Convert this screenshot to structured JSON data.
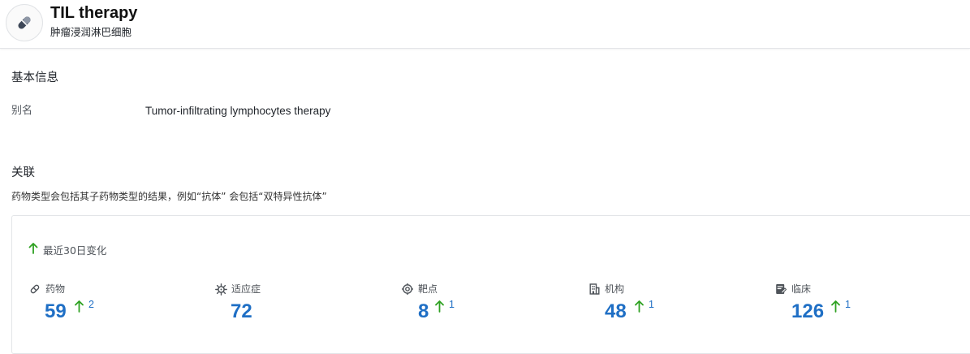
{
  "header": {
    "title": "TIL therapy",
    "subtitle": "肿瘤浸润淋巴细胞",
    "icon": "pill-icon"
  },
  "basic_info": {
    "section_title": "基本信息",
    "fields": [
      {
        "label": "别名",
        "value": "Tumor-infiltrating lymphocytes therapy"
      }
    ]
  },
  "related": {
    "section_title": "关联",
    "note": "药物类型会包括其子药物类型的结果，例如“抗体” 会包括“双特异性抗体”",
    "change_label": "最近30日变化",
    "stats": [
      {
        "label": "药物",
        "icon": "pill-icon",
        "value": "59",
        "delta": "2"
      },
      {
        "label": "适应症",
        "icon": "virus-icon",
        "value": "72",
        "delta": ""
      },
      {
        "label": "靶点",
        "icon": "target-icon",
        "value": "8",
        "delta": "1"
      },
      {
        "label": "机构",
        "icon": "building-icon",
        "value": "48",
        "delta": "1"
      },
      {
        "label": "临床",
        "icon": "clipboard-icon",
        "value": "126",
        "delta": "1"
      }
    ]
  },
  "colors": {
    "accent": "#1f6fc5",
    "up_arrow": "#2ea121",
    "icon": "#4e5359"
  }
}
